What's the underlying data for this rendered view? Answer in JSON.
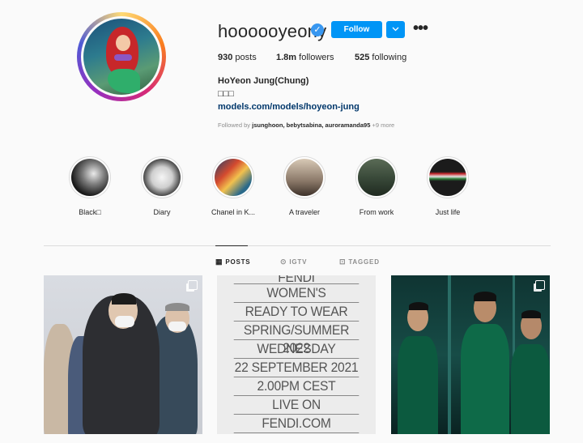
{
  "profile": {
    "username": "hoooooyeony",
    "verified_mark": "✓",
    "follow_label": "Follow",
    "dropdown_icon": "chevron-down-icon",
    "more_icon": "•••",
    "posts": "930",
    "posts_label": "posts",
    "followers": "1.8m",
    "followers_label": "followers",
    "following": "525",
    "following_label": "following",
    "full_name": "HoYeon Jung(Chung)",
    "bio": "□□□",
    "link": "models.com/models/hoyeon-jung",
    "followed_by_prefix": "Followed by",
    "followed_by_names": "jsunghoon, bebytsabina, auroramanda95",
    "followed_by_more": "+9 more"
  },
  "highlights": [
    {
      "label": "Black□"
    },
    {
      "label": "Diary"
    },
    {
      "label": "Chanel in K..."
    },
    {
      "label": "A traveler"
    },
    {
      "label": "From work"
    },
    {
      "label": "Just life"
    }
  ],
  "tabs": [
    {
      "label": "POSTS",
      "icon": "grid-icon",
      "active": true
    },
    {
      "label": "IGTV",
      "icon": "igtv-icon",
      "active": false
    },
    {
      "label": "TAGGED",
      "icon": "tag-icon",
      "active": false
    }
  ],
  "posts": {
    "fendi_lines": [
      "FENDI",
      "WOMEN'S",
      "READY TO WEAR",
      "SPRING/SUMMER 2022",
      "WEDNESDAY",
      "22 SEPTEMBER 2021",
      "2.00PM CEST",
      "LIVE ON",
      "FENDI.COM"
    ]
  },
  "colors": {
    "accent": "#0095f6",
    "link": "#00376b",
    "muted": "#8e8e8e"
  }
}
